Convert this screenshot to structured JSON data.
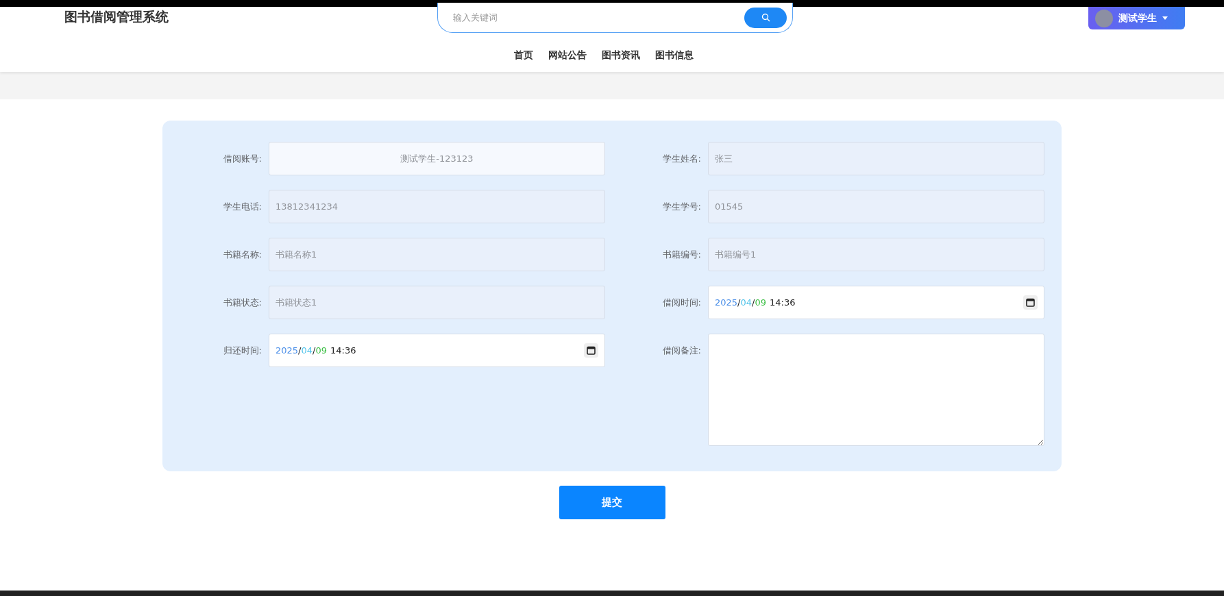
{
  "header": {
    "title": "图书借阅管理系统",
    "search": {
      "placeholder": "输入关键词"
    },
    "user": {
      "name": "测试学生"
    }
  },
  "nav": [
    {
      "label": "首页"
    },
    {
      "label": "网站公告"
    },
    {
      "label": "图书资讯"
    },
    {
      "label": "图书信息"
    }
  ],
  "form": {
    "fields": [
      {
        "label": "借阅账号:",
        "kind": "centered",
        "value": "测试学生-123123"
      },
      {
        "label": "学生姓名:",
        "kind": "readonly",
        "value": "张三"
      },
      {
        "label": "学生电话:",
        "kind": "readonly",
        "value": "13812341234"
      },
      {
        "label": "学生学号:",
        "kind": "readonly",
        "value": "01545"
      },
      {
        "label": "书籍名称:",
        "kind": "readonly",
        "value": "书籍名称1"
      },
      {
        "label": "书籍编号:",
        "kind": "readonly",
        "value": "书籍编号1"
      },
      {
        "label": "书籍状态:",
        "kind": "readonly",
        "value": "书籍状态1"
      },
      {
        "label": "借阅时间:",
        "kind": "datetime",
        "date": {
          "year": "2025",
          "month": "04",
          "day": "09",
          "separator": "/",
          "time": "14:36"
        }
      },
      {
        "label": "归还时间:",
        "kind": "datetime",
        "date": {
          "year": "2025",
          "month": "04",
          "day": "09",
          "separator": "/",
          "time": "14:36"
        }
      },
      {
        "label": "借阅备注:",
        "kind": "textarea"
      }
    ],
    "submit": "提交"
  }
}
